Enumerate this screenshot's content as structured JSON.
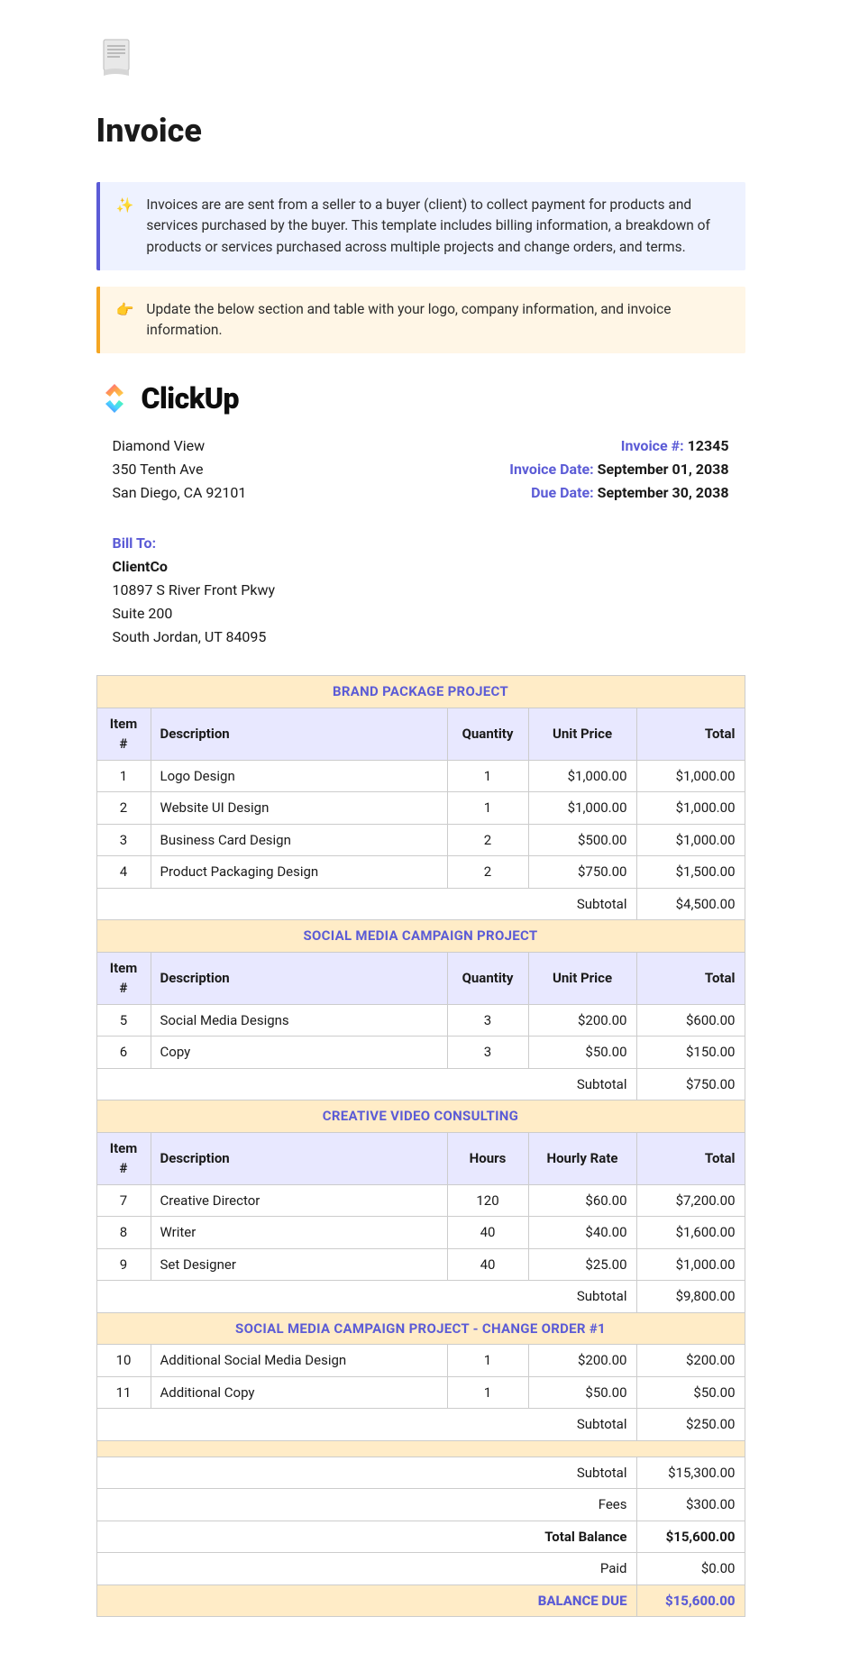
{
  "doc_title": "Invoice",
  "callouts": {
    "intro": "Invoices are are sent from a seller to a buyer (client) to collect payment for products and services purchased by the buyer. This template includes billing information, a breakdown of products or services purchased across multiple projects and change orders, and terms.",
    "instruction": "Update the below section and table with your logo, company information, and invoice information."
  },
  "company": {
    "logo_text": "ClickUp",
    "name": "Diamond View",
    "addr1": "350 Tenth Ave",
    "addr2": "San Diego, CA 92101"
  },
  "meta": {
    "invoice_num_label": "Invoice #:",
    "invoice_num": "12345",
    "invoice_date_label": "Invoice Date:",
    "invoice_date": "September 01, 2038",
    "due_date_label": "Due Date:",
    "due_date": "September 30, 2038"
  },
  "bill_to": {
    "label": "Bill To:",
    "name": "ClientCo",
    "addr1": "10897 S River Front Pkwy",
    "addr2": "Suite 200",
    "addr3": "South Jordan, UT 84095"
  },
  "cols": {
    "item": "Item #",
    "desc": "Description",
    "qty": "Quantity",
    "hours": "Hours",
    "unit_price": "Unit Price",
    "hourly_rate": "Hourly Rate",
    "total": "Total",
    "subtotal": "Subtotal"
  },
  "sections": [
    {
      "title": "BRAND PACKAGE PROJECT",
      "qty_label_key": "qty",
      "price_label_key": "unit_price",
      "rows": [
        {
          "n": "1",
          "desc": "Logo Design",
          "qty": "1",
          "price": "$1,000.00",
          "total": "$1,000.00"
        },
        {
          "n": "2",
          "desc": "Website UI Design",
          "qty": "1",
          "price": "$1,000.00",
          "total": "$1,000.00"
        },
        {
          "n": "3",
          "desc": "Business Card Design",
          "qty": "2",
          "price": "$500.00",
          "total": "$1,000.00"
        },
        {
          "n": "4",
          "desc": "Product Packaging Design",
          "qty": "2",
          "price": "$750.00",
          "total": "$1,500.00"
        }
      ],
      "subtotal": "$4,500.00"
    },
    {
      "title": "SOCIAL MEDIA CAMPAIGN PROJECT",
      "qty_label_key": "qty",
      "price_label_key": "unit_price",
      "rows": [
        {
          "n": "5",
          "desc": "Social Media Designs",
          "qty": "3",
          "price": "$200.00",
          "total": "$600.00"
        },
        {
          "n": "6",
          "desc": "Copy",
          "qty": "3",
          "price": "$50.00",
          "total": "$150.00"
        }
      ],
      "subtotal": "$750.00"
    },
    {
      "title": "CREATIVE VIDEO CONSULTING",
      "qty_label_key": "hours",
      "price_label_key": "hourly_rate",
      "rows": [
        {
          "n": "7",
          "desc": "Creative Director",
          "qty": "120",
          "price": "$60.00",
          "total": "$7,200.00"
        },
        {
          "n": "8",
          "desc": "Writer",
          "qty": "40",
          "price": "$40.00",
          "total": "$1,600.00"
        },
        {
          "n": "9",
          "desc": "Set Designer",
          "qty": "40",
          "price": "$25.00",
          "total": "$1,000.00"
        }
      ],
      "subtotal": "$9,800.00"
    },
    {
      "title": "SOCIAL MEDIA CAMPAIGN PROJECT - CHANGE ORDER #1",
      "no_headers": true,
      "rows": [
        {
          "n": "10",
          "desc": "Additional Social Media Design",
          "qty": "1",
          "price": "$200.00",
          "total": "$200.00"
        },
        {
          "n": "11",
          "desc": "Additional Copy",
          "qty": "1",
          "price": "$50.00",
          "total": "$50.00"
        }
      ],
      "subtotal": "$250.00"
    }
  ],
  "summary": {
    "subtotal_label": "Subtotal",
    "subtotal": "$15,300.00",
    "fees_label": "Fees",
    "fees": "$300.00",
    "total_balance_label": "Total Balance",
    "total_balance": "$15,600.00",
    "paid_label": "Paid",
    "paid": "$0.00",
    "balance_due_label": "BALANCE DUE",
    "balance_due": "$15,600.00"
  }
}
